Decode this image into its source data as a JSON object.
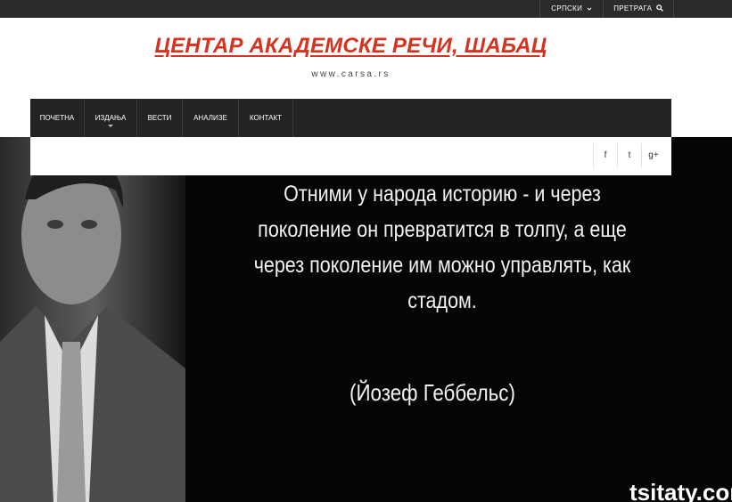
{
  "topbar": {
    "language": "СРПСКИ",
    "search_label": "ПРЕТРАГА"
  },
  "header": {
    "title": "ЦЕНТАР АКАДЕМСКЕ РЕЧИ, ШАБАЦ",
    "url": "www.carsa.rs"
  },
  "nav": {
    "items": [
      {
        "label": "ПОЧЕТНА"
      },
      {
        "label": "ИЗДАЊА"
      },
      {
        "label": "ВЕСТИ"
      },
      {
        "label": "АНАЛИЗЕ"
      },
      {
        "label": "КОНТАКТ"
      }
    ]
  },
  "social": {
    "facebook": "f",
    "twitter": "t",
    "googleplus": "g+"
  },
  "hero": {
    "quote_lines": [
      "Отними у народа историю - и через",
      "поколение он превратится в толпу, а еще",
      "через поколение им можно управлять, как",
      "стадом."
    ],
    "author": "(Йозеф Геббельс)",
    "watermark": "tsitaty.com"
  },
  "colors": {
    "title_red": "#d5321f",
    "nav_dark": "#232323",
    "topbar_dark": "#2b2b2b"
  }
}
